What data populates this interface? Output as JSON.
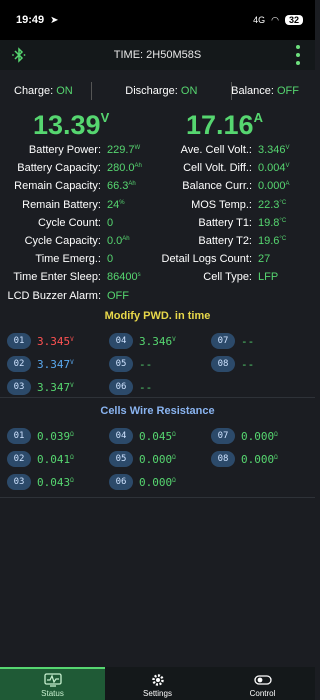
{
  "status_bar": {
    "time": "19:49",
    "network": "4G",
    "battery": "32"
  },
  "header": {
    "title": "TIME: 2H50M58S"
  },
  "toggles": [
    {
      "label": "Charge:",
      "value": "ON"
    },
    {
      "label": "Discharge:",
      "value": "ON"
    },
    {
      "label": "Balance:",
      "value": "OFF"
    }
  ],
  "main": {
    "voltage": "13.39",
    "voltage_unit": "V",
    "current": "17.16",
    "current_unit": "A"
  },
  "left_stats": [
    {
      "label": "Battery Power:",
      "value": "229.7",
      "unit": "W"
    },
    {
      "label": "Battery Capacity:",
      "value": "280.0",
      "unit": "Ah"
    },
    {
      "label": "Remain Capacity:",
      "value": "66.3",
      "unit": "Ah"
    },
    {
      "label": "Remain Battery:",
      "value": "24",
      "unit": "%"
    },
    {
      "label": "Cycle Count:",
      "value": "0",
      "unit": ""
    },
    {
      "label": "Cycle Capacity:",
      "value": "0.0",
      "unit": "Ah"
    },
    {
      "label": "Time Emerg.:",
      "value": "0",
      "unit": ""
    },
    {
      "label": "Time Enter Sleep:",
      "value": "86400",
      "unit": "s"
    },
    {
      "label": "LCD Buzzer Alarm:",
      "value": "OFF",
      "unit": ""
    }
  ],
  "right_stats": [
    {
      "label": "Ave. Cell Volt.:",
      "value": "3.346",
      "unit": "V"
    },
    {
      "label": "Cell Volt. Diff.:",
      "value": "0.004",
      "unit": "V"
    },
    {
      "label": "Balance Curr.:",
      "value": "0.000",
      "unit": "A"
    },
    {
      "label": "MOS Temp.:",
      "value": "22.3",
      "unit": "°C"
    },
    {
      "label": "Battery T1:",
      "value": "19.8",
      "unit": "°C"
    },
    {
      "label": "Battery T2:",
      "value": "19.6",
      "unit": "°C"
    },
    {
      "label": "Detail Logs Count:",
      "value": "27",
      "unit": ""
    },
    {
      "label": "Cell Type:",
      "value": "LFP",
      "unit": ""
    }
  ],
  "section_pwd": {
    "title": "Modify PWD. in time"
  },
  "cells": [
    {
      "id": "01",
      "value": "3.345",
      "unit": "V",
      "color": "#ff5252"
    },
    {
      "id": "02",
      "value": "3.347",
      "unit": "V",
      "color": "#5aa9f0"
    },
    {
      "id": "03",
      "value": "3.347",
      "unit": "V",
      "color": "#56d670"
    },
    {
      "id": "04",
      "value": "3.346",
      "unit": "V",
      "color": "#56d670"
    },
    {
      "id": "05",
      "value": "--",
      "unit": "",
      "color": "#56d670"
    },
    {
      "id": "06",
      "value": "--",
      "unit": "",
      "color": "#56d670"
    },
    {
      "id": "07",
      "value": "--",
      "unit": "",
      "color": "#56d670"
    },
    {
      "id": "08",
      "value": "--",
      "unit": "",
      "color": "#56d670"
    }
  ],
  "section_wire": {
    "title": "Cells Wire Resistance"
  },
  "wires": [
    {
      "id": "01",
      "value": "0.039",
      "unit": "Ω"
    },
    {
      "id": "02",
      "value": "0.041",
      "unit": "Ω"
    },
    {
      "id": "03",
      "value": "0.043",
      "unit": "Ω"
    },
    {
      "id": "04",
      "value": "0.045",
      "unit": "Ω"
    },
    {
      "id": "05",
      "value": "0.000",
      "unit": "Ω"
    },
    {
      "id": "06",
      "value": "0.000",
      "unit": "Ω"
    },
    {
      "id": "07",
      "value": "0.000",
      "unit": "Ω"
    },
    {
      "id": "08",
      "value": "0.000",
      "unit": "Ω"
    }
  ],
  "tabs": [
    {
      "label": "Status",
      "icon": "status-icon",
      "active": true
    },
    {
      "label": "Settings",
      "icon": "gear-icon",
      "active": false
    },
    {
      "label": "Control",
      "icon": "toggle-icon",
      "active": false
    }
  ],
  "colors": {
    "accent": "#56d670",
    "alarm": "#ff5252",
    "info": "#5aa9f0",
    "title_yellow": "#e8d84a"
  }
}
